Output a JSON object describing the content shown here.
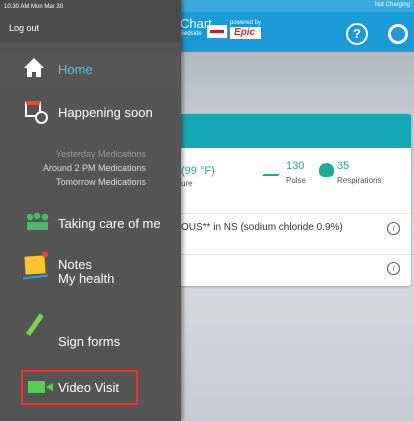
{
  "status_bar": {
    "time": "10:30 AM  Mon Mar 30",
    "charging": "Not Charging"
  },
  "header": {
    "brand": "Chart",
    "brand_sub": "Bedside",
    "powered_by": "powered by",
    "epic": "Epic"
  },
  "drawer": {
    "logout": "Log out",
    "items": [
      {
        "label": "Home",
        "icon": "home-icon"
      },
      {
        "label": "Happening soon",
        "icon": "calendar-clock-icon"
      },
      {
        "label": "Taking care of me",
        "icon": "care-team-icon"
      },
      {
        "label": "Notes",
        "icon": "notes-icon"
      },
      {
        "label": "My health",
        "icon": "health-icon"
      },
      {
        "label": "Sign forms",
        "icon": "pen-icon"
      },
      {
        "label": "Video Visit",
        "icon": "video-camera-icon"
      }
    ],
    "happening": {
      "yesterday": "Yesterday  Medications",
      "around": "Around 2 PM  Medications",
      "tomorrow": "Tomorrow  Medications"
    }
  },
  "card": {
    "temperature": "(99 °F)",
    "temperature_label": "ure",
    "pulse_value": "130",
    "pulse_label": "Pulse",
    "respirations_value": "35",
    "respirations_label": "Respirations",
    "medication": "OUS** in NS (sodium chloride 0.9%)",
    "info": "i"
  },
  "colors": {
    "accent": "#1a9ad6",
    "selected": "#51c3f0",
    "card_header": "#14a9b4",
    "highlight": "#ff2c24"
  }
}
